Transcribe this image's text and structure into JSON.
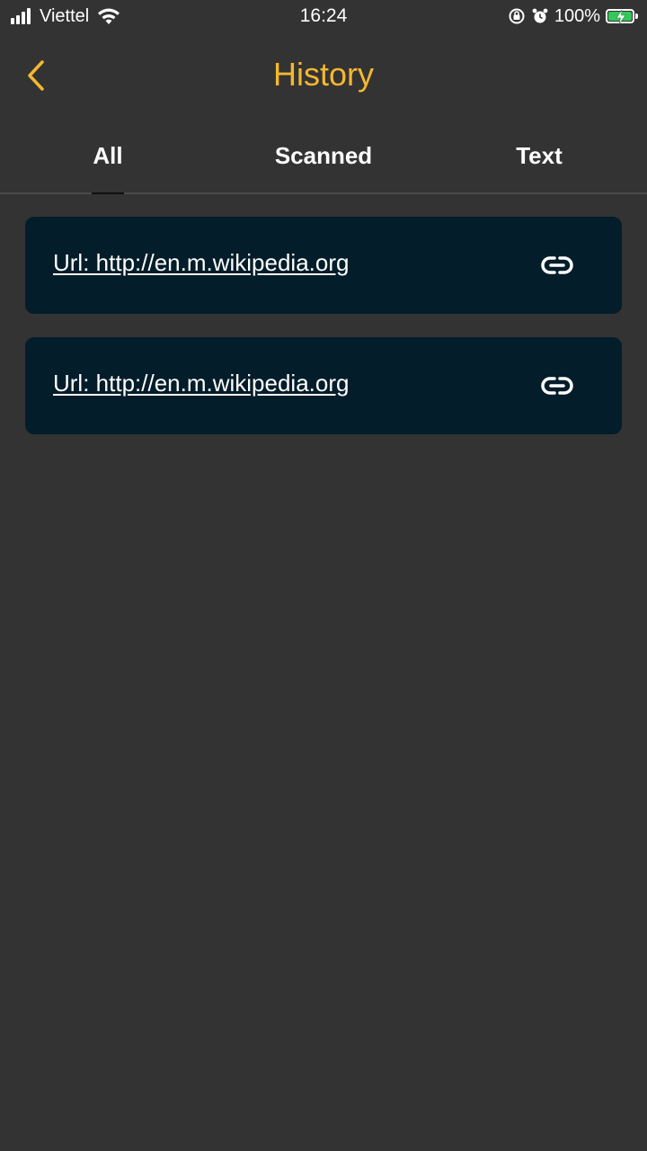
{
  "status_bar": {
    "carrier": "Viettel",
    "time": "16:24",
    "battery_percent": "100%",
    "battery_level": 1.0,
    "signal_bars": 4,
    "icons": [
      "signal-icon",
      "wifi-icon",
      "orientation-lock-icon",
      "alarm-icon",
      "battery-charging-icon"
    ]
  },
  "header": {
    "title": "History",
    "back_icon": "chevron-left-icon"
  },
  "tabs": [
    {
      "label": "All",
      "selected": true
    },
    {
      "label": "Scanned",
      "selected": false
    },
    {
      "label": "Text",
      "selected": false
    }
  ],
  "history_items": [
    {
      "text": "Url: http://en.m.wikipedia.org",
      "icon": "link-icon"
    },
    {
      "text": "Url: http://en.m.wikipedia.org",
      "icon": "link-icon"
    }
  ],
  "colors": {
    "background": "#333333",
    "accent": "#f5b731",
    "card_background": "#031d2a",
    "battery_green": "#34c759"
  }
}
